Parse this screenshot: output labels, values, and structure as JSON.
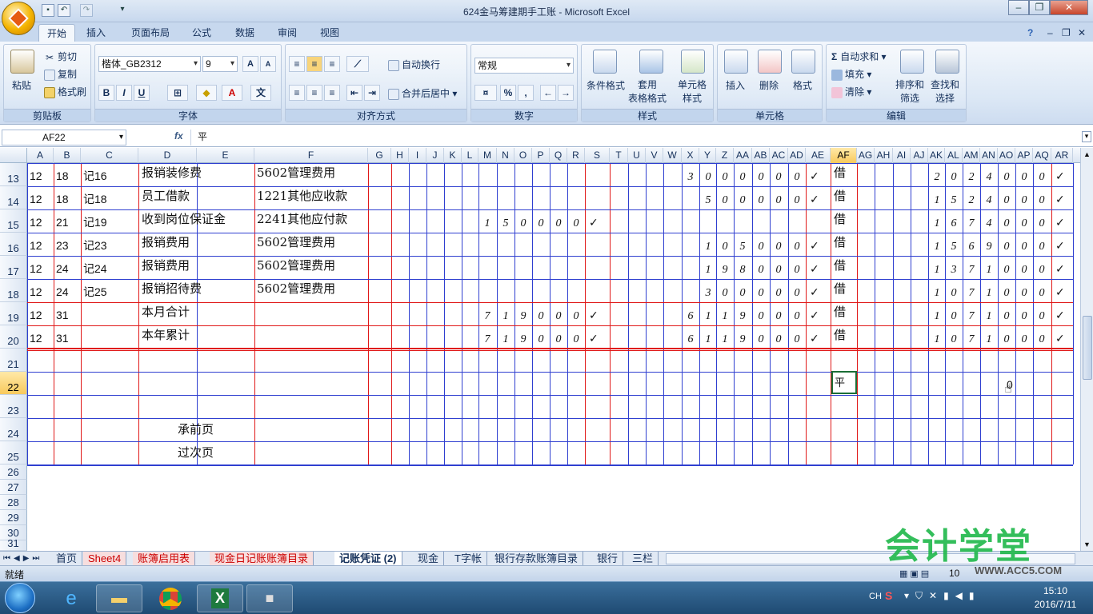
{
  "window": {
    "title": "624金马筹建期手工账 - Microsoft Excel"
  },
  "ribbon_tabs": [
    "开始",
    "插入",
    "页面布局",
    "公式",
    "数据",
    "审阅",
    "视图"
  ],
  "clipboard": {
    "paste": "粘贴",
    "cut": "剪切",
    "copy": "复制",
    "painter": "格式刷",
    "label": "剪贴板"
  },
  "font": {
    "name": "楷体_GB2312",
    "size": "9",
    "bold": "B",
    "italic": "I",
    "underline": "U",
    "label": "字体"
  },
  "alignment": {
    "wrap": "自动换行",
    "merge": "合并后居中",
    "label": "对齐方式"
  },
  "number": {
    "format": "常规",
    "percent": "%",
    "comma": ",",
    "label": "数字"
  },
  "styles": {
    "conditional": "条件格式",
    "table": "套用\n表格格式",
    "cell": "单元格\n样式",
    "label": "样式"
  },
  "cells": {
    "insert": "插入",
    "delete": "删除",
    "format": "格式",
    "label": "单元格"
  },
  "editing": {
    "autosum": "自动求和",
    "fill": "填充",
    "clear": "清除",
    "sort": "排序和\n筛选",
    "find": "查找和\n选择",
    "label": "编辑"
  },
  "formula_bar": {
    "name_box": "AF22",
    "fx": "fx",
    "value": "平"
  },
  "columns": [
    "A",
    "B",
    "C",
    "D",
    "E",
    "F",
    "G",
    "H",
    "I",
    "J",
    "K",
    "L",
    "M",
    "N",
    "O",
    "P",
    "Q",
    "R",
    "S",
    "T",
    "U",
    "V",
    "W",
    "X",
    "Y",
    "Z",
    "AA",
    "AB",
    "AC",
    "AD",
    "AE",
    "AF",
    "AG",
    "AH",
    "AI",
    "AJ",
    "AK",
    "AL",
    "AM",
    "AN",
    "AO",
    "AP",
    "AQ",
    "AR"
  ],
  "row_numbers": [
    "13",
    "14",
    "15",
    "16",
    "17",
    "18",
    "19",
    "20",
    "21",
    "22",
    "23",
    "24",
    "25",
    "26",
    "27",
    "28",
    "29",
    "30",
    "31"
  ],
  "rows": [
    {
      "a": "12",
      "b": "18",
      "c": "记16",
      "d": "报销装修费",
      "f": "5602管理费用",
      "debit": "",
      "credit": "3000000",
      "chk1": "",
      "chk2": "✓",
      "dir": "借",
      "bal": "2024000",
      "chk3": "✓"
    },
    {
      "a": "12",
      "b": "18",
      "c": "记18",
      "d": "员工借款",
      "f": "1221其他应收款",
      "debit": "",
      "credit": "500000",
      "chk1": "",
      "chk2": "✓",
      "dir": "借",
      "bal": "1524000",
      "chk3": "✓"
    },
    {
      "a": "12",
      "b": "21",
      "c": "记19",
      "d": "收到岗位保证金",
      "f": "2241其他应付款",
      "debit": "150000",
      "credit": "",
      "chk1": "✓",
      "chk2": "",
      "dir": "借",
      "bal": "1674000",
      "chk3": "✓"
    },
    {
      "a": "12",
      "b": "23",
      "c": "记23",
      "d": "报销费用",
      "f": "5602管理费用",
      "debit": "",
      "credit": "105000",
      "chk1": "",
      "chk2": "✓",
      "dir": "借",
      "bal": "1569000",
      "chk3": "✓"
    },
    {
      "a": "12",
      "b": "24",
      "c": "记24",
      "d": "报销费用",
      "f": "5602管理费用",
      "debit": "",
      "credit": "198000",
      "chk1": "",
      "chk2": "✓",
      "dir": "借",
      "bal": "1371000",
      "chk3": "✓"
    },
    {
      "a": "12",
      "b": "24",
      "c": "记25",
      "d": "报销招待费",
      "f": "5602管理费用",
      "debit": "",
      "credit": "300000",
      "chk1": "",
      "chk2": "✓",
      "dir": "借",
      "bal": "1071000",
      "chk3": "✓"
    },
    {
      "a": "12",
      "b": "31",
      "c": "",
      "d": "本月合计",
      "f": "",
      "debit": "719000",
      "credit": "6119000",
      "chk1": "✓",
      "chk2": "✓",
      "dir": "借",
      "bal": "1071000",
      "chk3": "✓"
    },
    {
      "a": "12",
      "b": "31",
      "c": "",
      "d": "本年累计",
      "f": "",
      "debit": "719000",
      "credit": "6119000",
      "chk1": "✓",
      "chk2": "✓",
      "dir": "借",
      "bal": "1071000",
      "chk3": "✓"
    }
  ],
  "footer_rows": {
    "carry_forward": "承前页",
    "carry_over": "过次页",
    "ao22": "0"
  },
  "selected_cell_value": "平",
  "sheet_tabs": [
    {
      "label": "首页",
      "red": false
    },
    {
      "label": "Sheet4",
      "red": true
    },
    {
      "label": "账簿启用表",
      "red": true
    },
    {
      "label": "现金日记账账簿目录",
      "red": true
    },
    {
      "label": "记账凭证 (2)",
      "red": false
    },
    {
      "label": "现金",
      "red": false
    },
    {
      "label": "T字帐",
      "red": false
    },
    {
      "label": "银行存款账簿目录",
      "red": false
    },
    {
      "label": "银行",
      "red": false
    },
    {
      "label": "三栏",
      "red": false
    }
  ],
  "status": {
    "ready": "就绪",
    "zoom": "10"
  },
  "watermark": {
    "text": "会计学堂",
    "url": "WWW.ACC5.COM"
  },
  "tray": {
    "lang": "CH",
    "time": "15:10",
    "date": "2016/7/11"
  }
}
